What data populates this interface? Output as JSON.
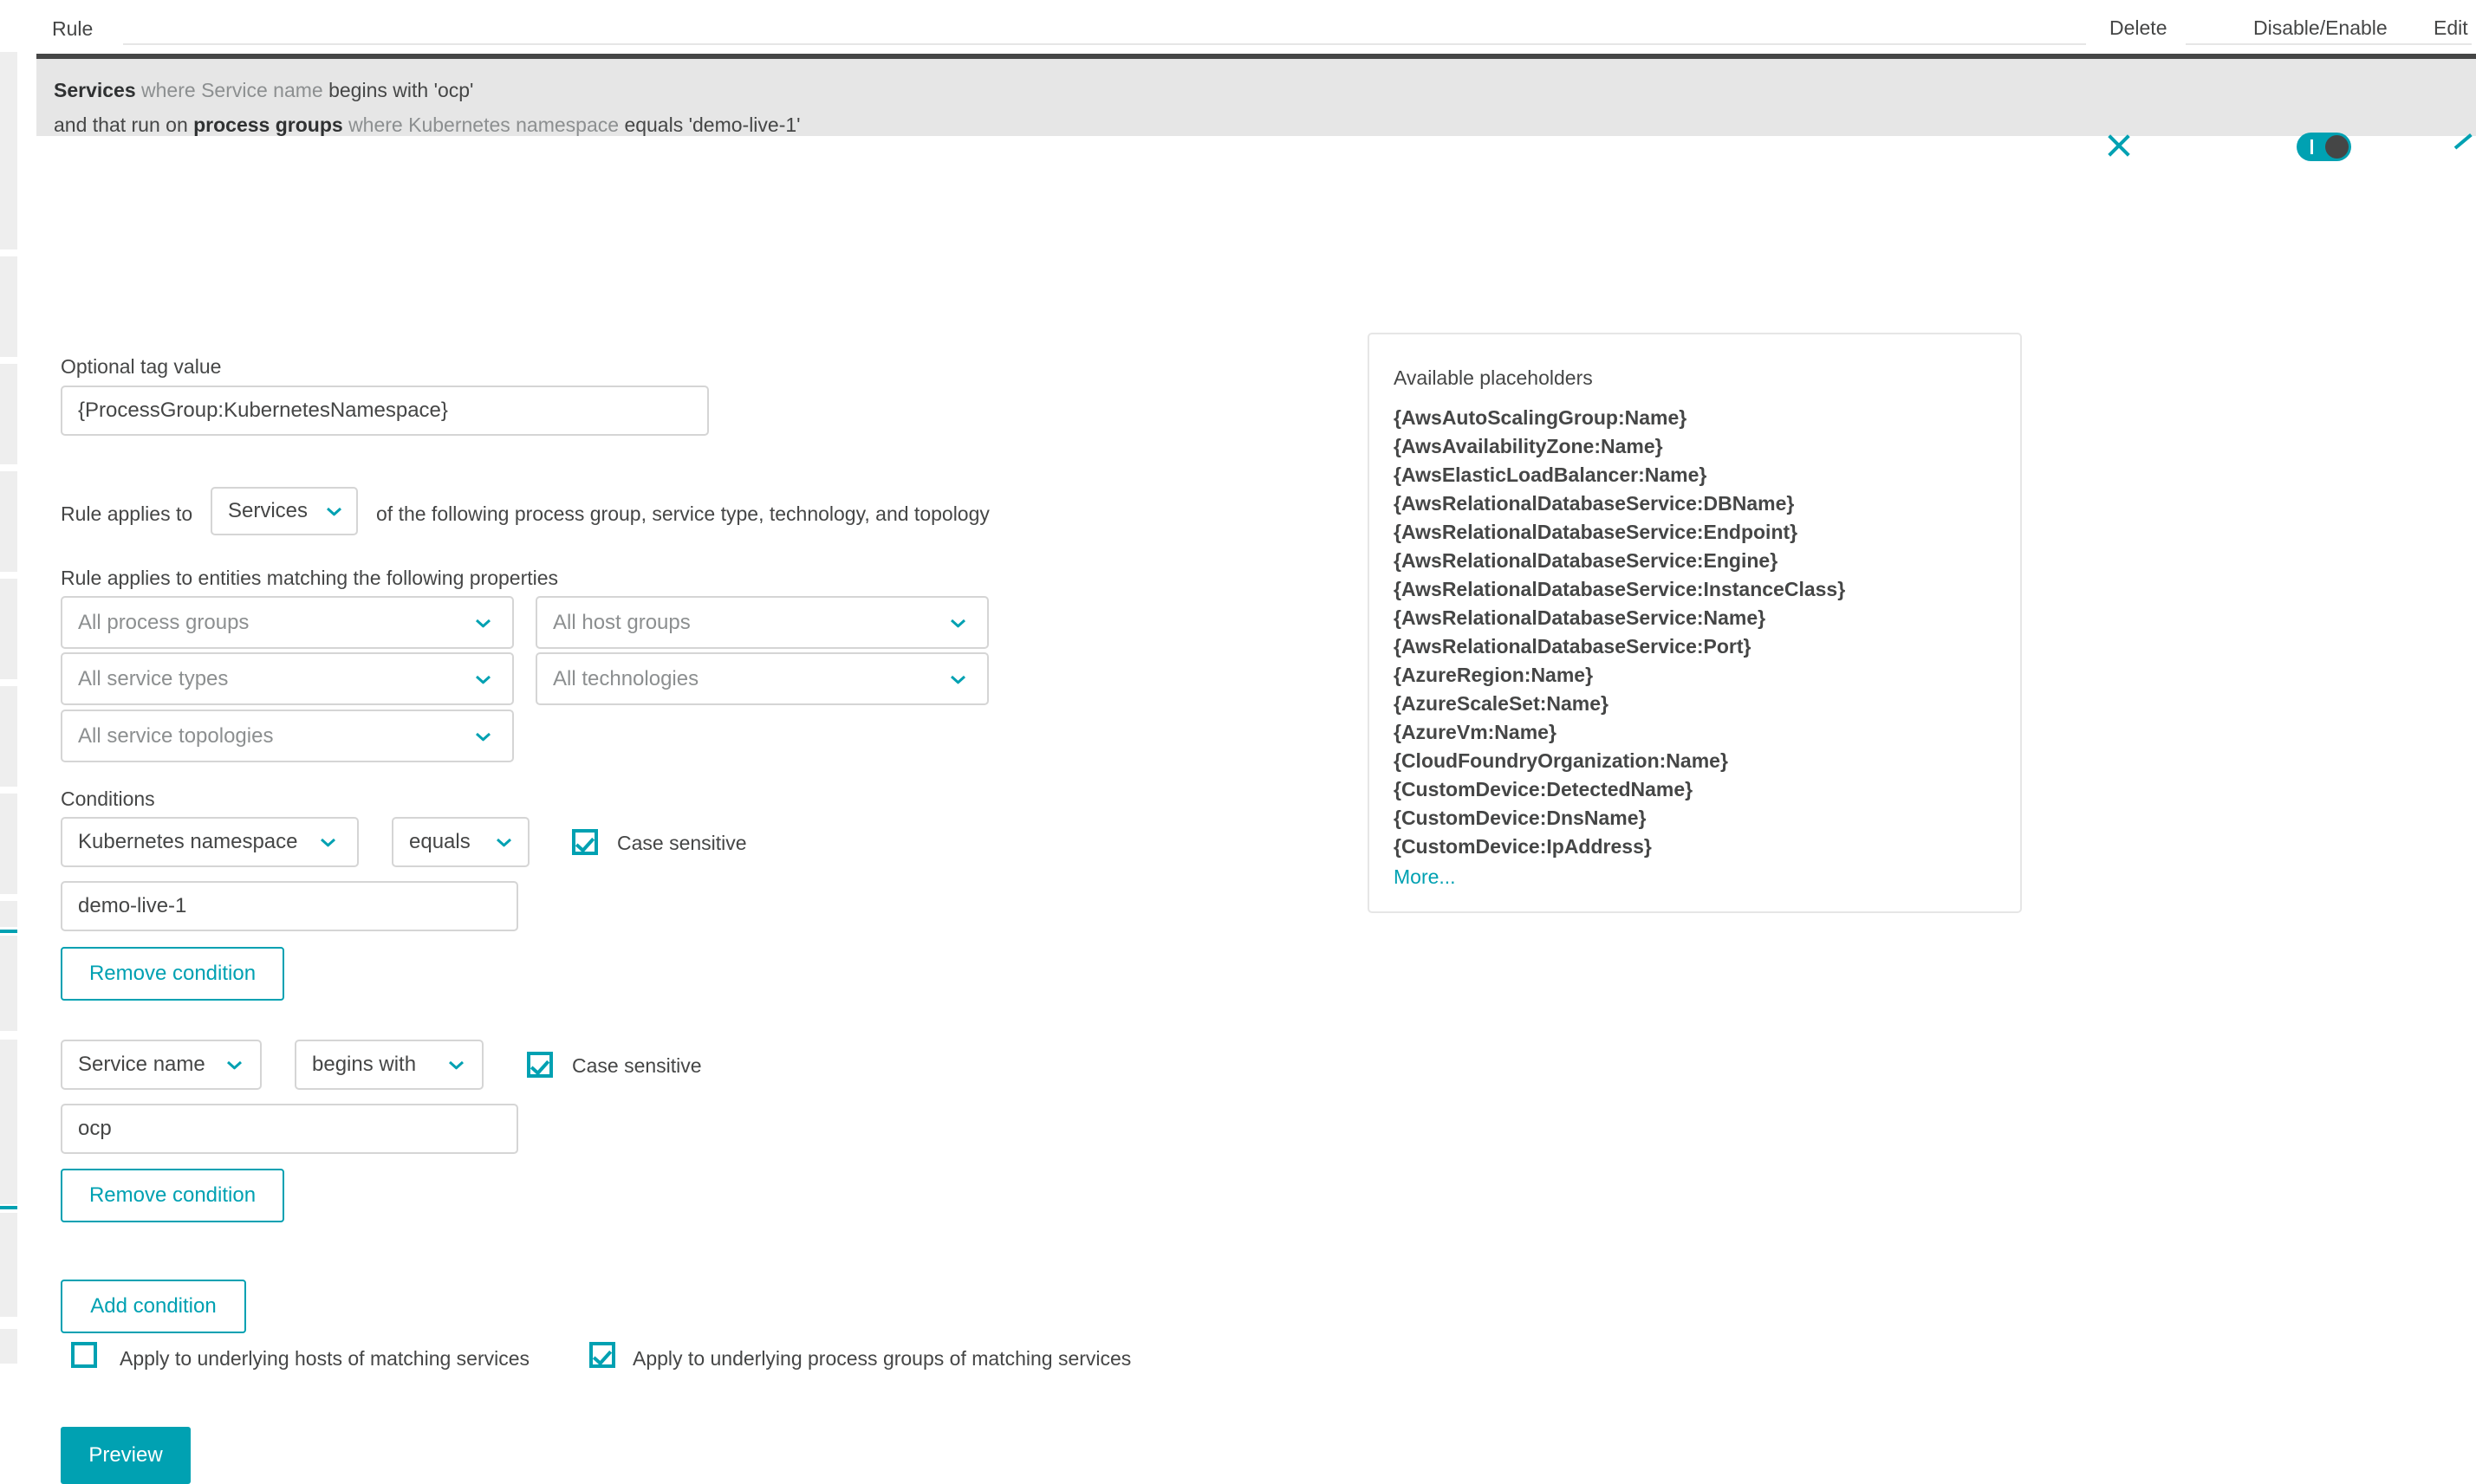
{
  "top_bar": {
    "rule_label": "Rule",
    "actions": [
      {
        "label": "Delete"
      },
      {
        "label": "Disable/Enable"
      },
      {
        "label": "Edit"
      }
    ]
  },
  "rule_card": {
    "line1": {
      "entity": "Services",
      "where": "where",
      "attribute": "Service name",
      "operator": "begins with",
      "value": "'ocp'"
    },
    "line2": {
      "prefix": "and that run on",
      "entity": "process groups",
      "where": "where",
      "attribute": "Kubernetes namespace",
      "operator": "equals",
      "value": "'demo-live-1'"
    },
    "close_icon": "close-icon",
    "toggle_state": "on",
    "collapse_icon": "chevron-up-icon"
  },
  "form": {
    "tag_value_label": "Optional tag value",
    "tag_value": "{ProcessGroup:KubernetesNamespace}",
    "applies_to_prefix": "Rule applies to",
    "applies_to_selected": "Services",
    "applies_to_suffix": "of the following process group, service type, technology, and topology",
    "properties_label": "Rule applies to entities matching the following properties",
    "property_selects": [
      {
        "value": "All process groups",
        "is_placeholder": true
      },
      {
        "value": "All host groups",
        "is_placeholder": true
      },
      {
        "value": "All service types",
        "is_placeholder": true
      },
      {
        "value": "All technologies",
        "is_placeholder": true
      },
      {
        "value": "All service topologies",
        "is_placeholder": true
      }
    ],
    "conditions_label": "Conditions",
    "conditions": [
      {
        "attribute": "Kubernetes namespace",
        "operator": "equals",
        "case_sensitive_label": "Case sensitive",
        "case_sensitive_checked": true,
        "value": "demo-live-1",
        "remove_label": "Remove condition"
      },
      {
        "attribute": "Service name",
        "operator": "begins with",
        "case_sensitive_label": "Case sensitive",
        "case_sensitive_checked": true,
        "value": "ocp",
        "remove_label": "Remove condition"
      }
    ],
    "add_condition_label": "Add condition",
    "apply_hosts_label": "Apply to underlying hosts of matching services",
    "apply_hosts_checked": false,
    "apply_process_groups_label": "Apply to underlying process groups of matching services",
    "apply_process_groups_checked": true,
    "preview_label": "Preview"
  },
  "placeholders": {
    "title": "Available placeholders",
    "items": [
      "{AwsAutoScalingGroup:Name}",
      "{AwsAvailabilityZone:Name}",
      "{AwsElasticLoadBalancer:Name}",
      "{AwsRelationalDatabaseService:DBName}",
      "{AwsRelationalDatabaseService:Endpoint}",
      "{AwsRelationalDatabaseService:Engine}",
      "{AwsRelationalDatabaseService:InstanceClass}",
      "{AwsRelationalDatabaseService:Name}",
      "{AwsRelationalDatabaseService:Port}",
      "{AzureRegion:Name}",
      "{AzureScaleSet:Name}",
      "{AzureVm:Name}",
      "{CloudFoundryOrganization:Name}",
      "{CustomDevice:DetectedName}",
      "{CustomDevice:DnsName}",
      "{CustomDevice:IpAddress}"
    ],
    "more_label": "More..."
  },
  "theme": {
    "accent": "#00a1b2",
    "text": "#454646",
    "muted": "#8c8f90",
    "card_bg": "#e6e6e6",
    "card_top_border": "#454646",
    "field_border": "#d5d5d5"
  }
}
